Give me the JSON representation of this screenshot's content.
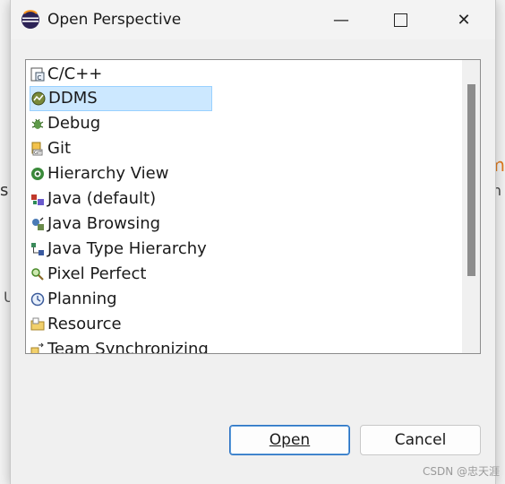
{
  "background": {
    "left_glyph": "s",
    "left_glyph2": "U",
    "right_glyph": "m",
    "right_glyph2": "n"
  },
  "dialog": {
    "title": "Open Perspective",
    "minimize": "—",
    "maximize": "☐",
    "close": "✕"
  },
  "perspectives": [
    {
      "label": "C/C++",
      "icon": "cpp-perspective-icon"
    },
    {
      "label": "DDMS",
      "icon": "ddms-perspective-icon",
      "selected": true
    },
    {
      "label": "Debug",
      "icon": "debug-bug-icon"
    },
    {
      "label": "Git",
      "icon": "git-icon"
    },
    {
      "label": "Hierarchy View",
      "icon": "hierarchy-view-icon"
    },
    {
      "label": "Java (default)",
      "icon": "java-perspective-icon"
    },
    {
      "label": "Java Browsing",
      "icon": "java-browsing-icon"
    },
    {
      "label": "Java Type Hierarchy",
      "icon": "java-type-hierarchy-icon"
    },
    {
      "label": "Pixel Perfect",
      "icon": "magnifier-icon"
    },
    {
      "label": "Planning",
      "icon": "planning-icon"
    },
    {
      "label": "Resource",
      "icon": "resource-folder-icon"
    },
    {
      "label": "Team Synchronizing",
      "icon": "team-sync-icon"
    }
  ],
  "buttons": {
    "open_label": "Open",
    "cancel_label": "Cancel"
  },
  "watermark": "CSDN @忠天涯",
  "colors": {
    "selection_bg": "#cce8ff",
    "selection_border": "#99d1ff",
    "default_button_border": "#2b73c4"
  }
}
